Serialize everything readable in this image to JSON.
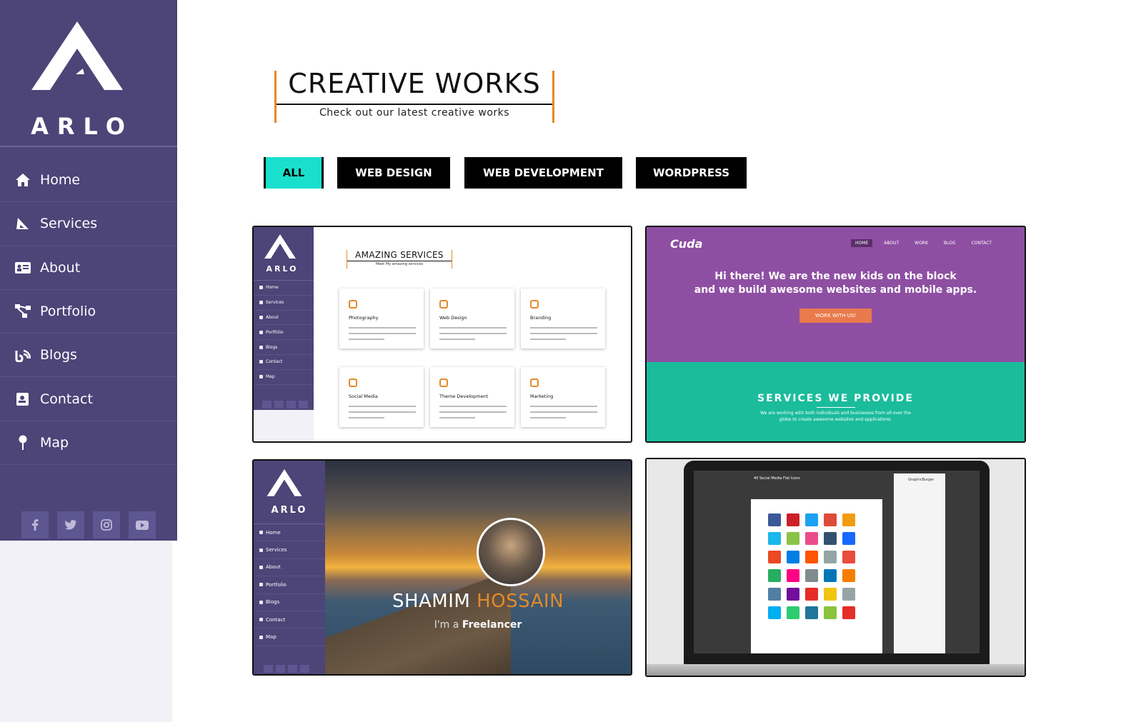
{
  "brand": {
    "name": "ARLO"
  },
  "sidebar": {
    "items": [
      {
        "label": "Home",
        "icon": "home-icon"
      },
      {
        "label": "Services",
        "icon": "services-icon"
      },
      {
        "label": "About",
        "icon": "id-card-icon"
      },
      {
        "label": "Portfolio",
        "icon": "sitemap-icon"
      },
      {
        "label": "Blogs",
        "icon": "blog-icon"
      },
      {
        "label": "Contact",
        "icon": "address-book-icon"
      },
      {
        "label": "Map",
        "icon": "map-pin-icon"
      }
    ],
    "social": [
      "facebook-icon",
      "twitter-icon",
      "instagram-icon",
      "youtube-icon"
    ]
  },
  "section": {
    "title": "CREATIVE WORKS",
    "subtitle": "Check out our latest creative works"
  },
  "filters": [
    {
      "label": "ALL",
      "active": true
    },
    {
      "label": "WEB DESIGN",
      "active": false
    },
    {
      "label": "WEB DEVELOPMENT",
      "active": false
    },
    {
      "label": "WORDPRESS",
      "active": false
    }
  ],
  "cards": {
    "services_preview": {
      "title": "AMAZING SERVICES",
      "subtitle": "Meet My amazing services",
      "nav": [
        "Home",
        "Services",
        "About",
        "Portfolio",
        "Blogs",
        "Contact",
        "Map"
      ],
      "services": [
        "Photography",
        "Web Design",
        "Branding",
        "Social Media",
        "Theme Development",
        "Marketing"
      ]
    },
    "cuda_preview": {
      "logo": "Cuda",
      "nav": [
        "HOME",
        "ABOUT",
        "WORK",
        "BLOG",
        "CONTACT"
      ],
      "hero_line1": "Hi there! We are the new kids on the block",
      "hero_line2": "and we build awesome websites and mobile apps.",
      "button": "WORK WITH US!",
      "services_title": "SERVICES WE PROVIDE",
      "services_sub1": "We are working with both individuals and businesses from all over the",
      "services_sub2": "globe to create awesome websites and applications."
    },
    "profile_preview": {
      "nav": [
        "Home",
        "Services",
        "About",
        "Portfolio",
        "Blogs",
        "Contact",
        "Map"
      ],
      "name_first": "SHAMIM",
      "name_last": "HOSSAIN",
      "tag_prefix": "I'm a",
      "tag_role": "Freelancer"
    },
    "laptop_preview": {
      "header": "40 Social Media Flat Icons",
      "author": "GraphicBurger"
    }
  },
  "colors": {
    "sidebar": "#4d4478",
    "accent_orange": "#e38a2a",
    "active_filter": "#19e0cd",
    "cuda_purple": "#8e4fa3",
    "cuda_teal": "#1abc9c"
  }
}
